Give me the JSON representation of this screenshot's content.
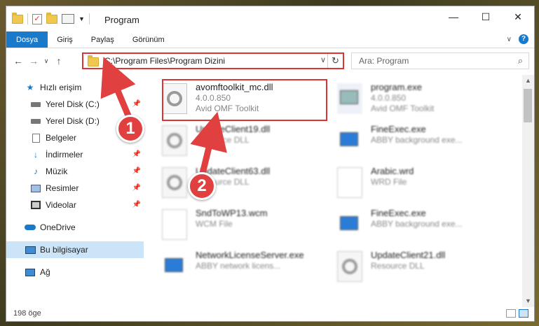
{
  "window": {
    "title": "Program"
  },
  "ribbon": {
    "tabs": [
      "Dosya",
      "Giriş",
      "Paylaş",
      "Görünüm"
    ]
  },
  "address": {
    "path": "C:\\Program Files\\Program Dizini"
  },
  "search": {
    "placeholder": "Ara: Program"
  },
  "sidebar": {
    "items": [
      {
        "label": "Hızlı erişim",
        "icon": "star-icon"
      },
      {
        "label": "Yerel Disk (C:)",
        "icon": "drive-icon"
      },
      {
        "label": "Yerel Disk (D:)",
        "icon": "drive-icon"
      },
      {
        "label": "Belgeler",
        "icon": "documents-icon"
      },
      {
        "label": "İndirmeler",
        "icon": "download-icon"
      },
      {
        "label": "Müzik",
        "icon": "music-icon"
      },
      {
        "label": "Resimler",
        "icon": "pictures-icon"
      },
      {
        "label": "Videolar",
        "icon": "video-icon"
      },
      {
        "label": "OneDrive",
        "icon": "cloud-icon"
      },
      {
        "label": "Bu bilgisayar",
        "icon": "computer-icon"
      },
      {
        "label": "Ağ",
        "icon": "network-icon"
      }
    ]
  },
  "files": [
    {
      "name": "avomftoolkit_mc.dll",
      "line1": "4.0.0.850",
      "line2": "Avid OMF Toolkit",
      "icon": "gear"
    },
    {
      "name": "program.exe",
      "line1": "4.0.0.850",
      "line2": "Avid OMF Toolkit",
      "icon": "app"
    },
    {
      "name": "UpdateClient19.dll",
      "line1": "Resource DLL",
      "line2": "",
      "icon": "gear"
    },
    {
      "name": "FineExec.exe",
      "line1": "ABBY background exe...",
      "line2": "",
      "icon": "blue"
    },
    {
      "name": "UpdateClient63.dll",
      "line1": "Resource DLL",
      "line2": "",
      "icon": "gear"
    },
    {
      "name": "Arabic.wrd",
      "line1": "WRD File",
      "line2": "",
      "icon": "blank"
    },
    {
      "name": "SndToWP13.wcm",
      "line1": "WCM File",
      "line2": "",
      "icon": "blank"
    },
    {
      "name": "FineExec.exe",
      "line1": "ABBY background exe...",
      "line2": "",
      "icon": "blue"
    },
    {
      "name": "NetworkLicenseServer.exe",
      "line1": "ABBY network licens...",
      "line2": "",
      "icon": "blue"
    },
    {
      "name": "UpdateClient21.dll",
      "line1": "Resource DLL",
      "line2": "",
      "icon": "gear"
    }
  ],
  "status": {
    "count_text": "198 öge"
  },
  "annotations": {
    "badge1": "1",
    "badge2": "2",
    "color": "#e04040"
  }
}
